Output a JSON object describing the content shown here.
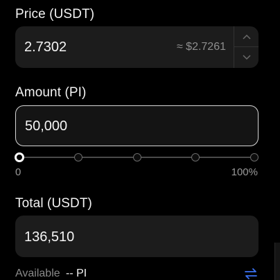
{
  "price": {
    "label": "Price (USDT)",
    "value": "2.7302",
    "approx": "≈ $2.7261"
  },
  "amount": {
    "label": "Amount (PI)",
    "value": "50,000"
  },
  "slider": {
    "min_label": "0",
    "max_label": "100%",
    "percent": 0,
    "marks": [
      0,
      25,
      50,
      75,
      100
    ]
  },
  "total": {
    "label": "Total (USDT)",
    "value": "136,510"
  },
  "available": {
    "label": "Available",
    "value": "-- PI"
  },
  "icons": {
    "stepper_up": "chevron-up-icon",
    "stepper_down": "chevron-down-icon",
    "swap": "swap-arrows-icon"
  },
  "colors": {
    "accent": "#3b73f5",
    "field_bg": "#1c1c1c"
  }
}
